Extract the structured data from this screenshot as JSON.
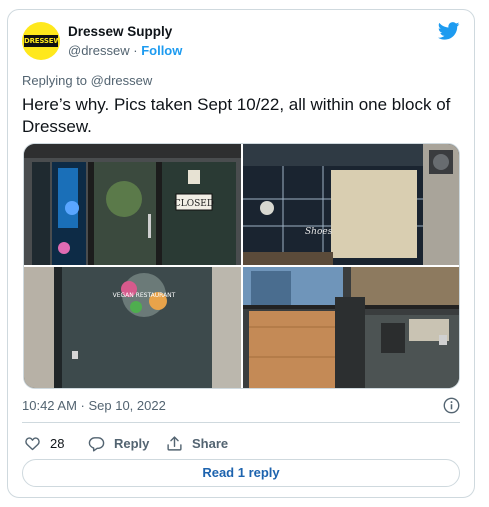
{
  "author": {
    "name": "Dressew Supply",
    "handle": "@dressew",
    "separator": "·",
    "follow_label": "Follow",
    "avatar_text": "DRESSEW"
  },
  "replying": {
    "prefix": "Replying to",
    "mention": "@dressew"
  },
  "tweet": {
    "text": "Here’s why. Pics taken Sept 10/22, all within one block of Dressew."
  },
  "media": {
    "photos": [
      {
        "sign_text": "CLOSED",
        "caption": ""
      },
      {
        "sign_text": "Shoes",
        "caption": ""
      },
      {
        "sign_text": "VEGAN RESTAURANT",
        "caption": ""
      },
      {
        "sign_text": "",
        "caption": ""
      }
    ]
  },
  "timestamp": "10:42 AM · Sep 10, 2022",
  "actions": {
    "like_count": "28",
    "reply_label": "Reply",
    "share_label": "Share"
  },
  "read_replies_label": "Read 1 reply",
  "colors": {
    "accent": "#1d9bf0",
    "link": "#1d63ae",
    "muted": "#536471",
    "border": "#cfd9de"
  },
  "icons": [
    "twitter-bird-icon",
    "info-icon",
    "heart-icon",
    "reply-icon",
    "share-icon"
  ]
}
